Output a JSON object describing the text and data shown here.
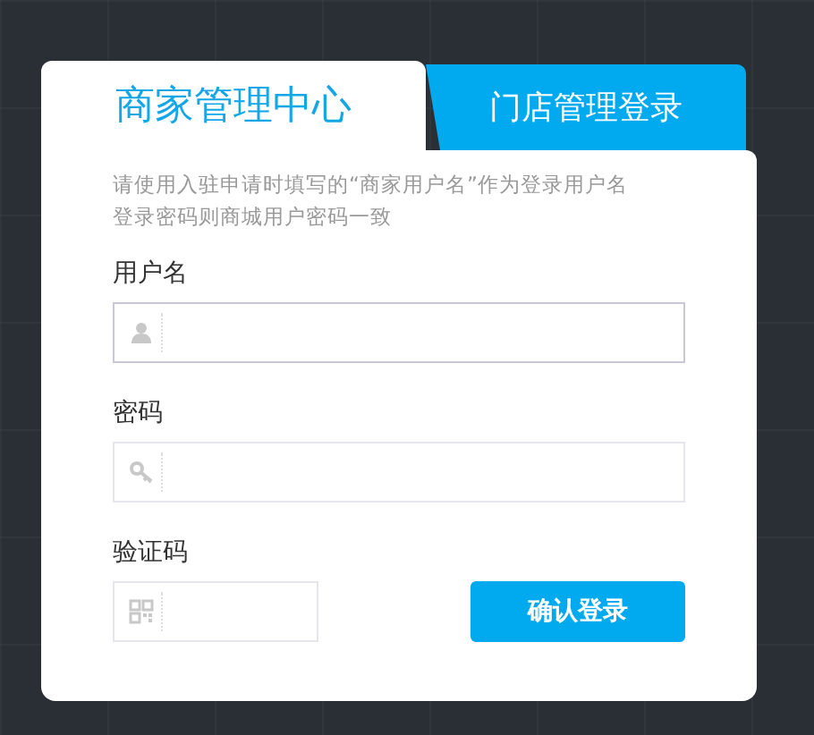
{
  "tabs": [
    {
      "label": "商家管理中心",
      "selected": true
    },
    {
      "label": "门店管理登录",
      "selected": false
    }
  ],
  "hint": [
    "请使用入驻申请时填写的“商家用户名”作为登录用户名",
    "登录密码则商城用户密码一致"
  ],
  "fields": [
    {
      "label": "用户名",
      "kind": "user",
      "focused": true
    },
    {
      "label": "密码",
      "kind": "password",
      "focused": false
    },
    {
      "label": "验证码",
      "kind": "captcha",
      "focused": false
    }
  ],
  "submit": "确认登录"
}
